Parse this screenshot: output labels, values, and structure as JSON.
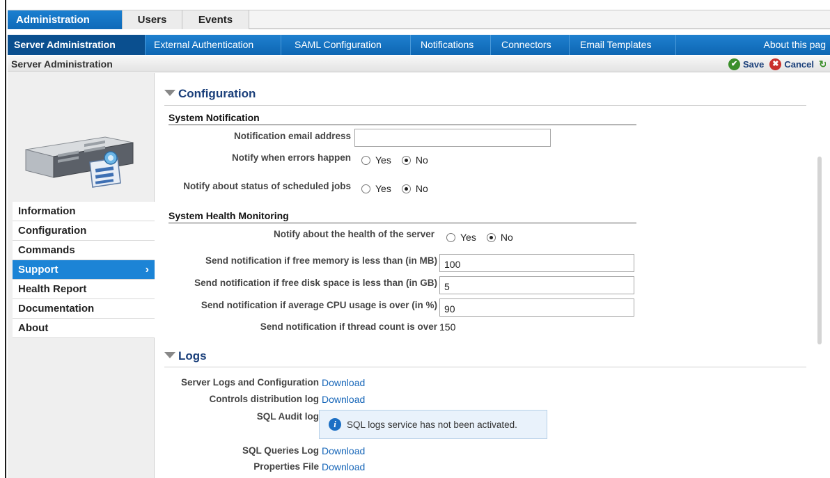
{
  "top_tabs": [
    "Administration",
    "Users",
    "Events"
  ],
  "sub_nav": {
    "items": [
      "Server Administration",
      "External Authentication",
      "SAML Configuration",
      "Notifications",
      "Connectors",
      "Email Templates"
    ],
    "about": "About this pag"
  },
  "crumb": {
    "title": "Server Administration",
    "save_label": "Save",
    "cancel_label": "Cancel"
  },
  "sidebar": {
    "items": [
      "Information",
      "Configuration",
      "Commands",
      "Support",
      "Health Report",
      "Documentation",
      "About"
    ],
    "active_index": 3
  },
  "configuration": {
    "heading": "Configuration",
    "system_notification": {
      "heading": "System Notification",
      "email_label": "Notification email address",
      "email_value": "",
      "errors_label": "Notify when errors happen",
      "errors_choice": "No",
      "jobs_label": "Notify about status of scheduled jobs",
      "jobs_choice": "No",
      "yes_label": "Yes",
      "no_label": "No"
    },
    "health": {
      "heading": "System Health Monitoring",
      "notify_label": "Notify about the health of the server",
      "notify_choice": "No",
      "memory_label": "Send notification if free memory is less than (in MB)",
      "memory_value": "100",
      "disk_label": "Send notification if free disk space is less than (in GB)",
      "disk_value": "5",
      "cpu_label": "Send notification if average CPU usage is over (in %)",
      "cpu_value": "90",
      "thread_label": "Send notification if thread count is over",
      "thread_value": "150"
    }
  },
  "logs": {
    "heading": "Logs",
    "download_label": "Download",
    "server_logs_label": "Server Logs and Configuration",
    "controls_label": "Controls distribution log",
    "sql_audit_label": "SQL Audit log",
    "sql_audit_message": "SQL logs service has not been activated.",
    "sql_queries_label": "SQL Queries Log",
    "properties_label": "Properties File"
  }
}
